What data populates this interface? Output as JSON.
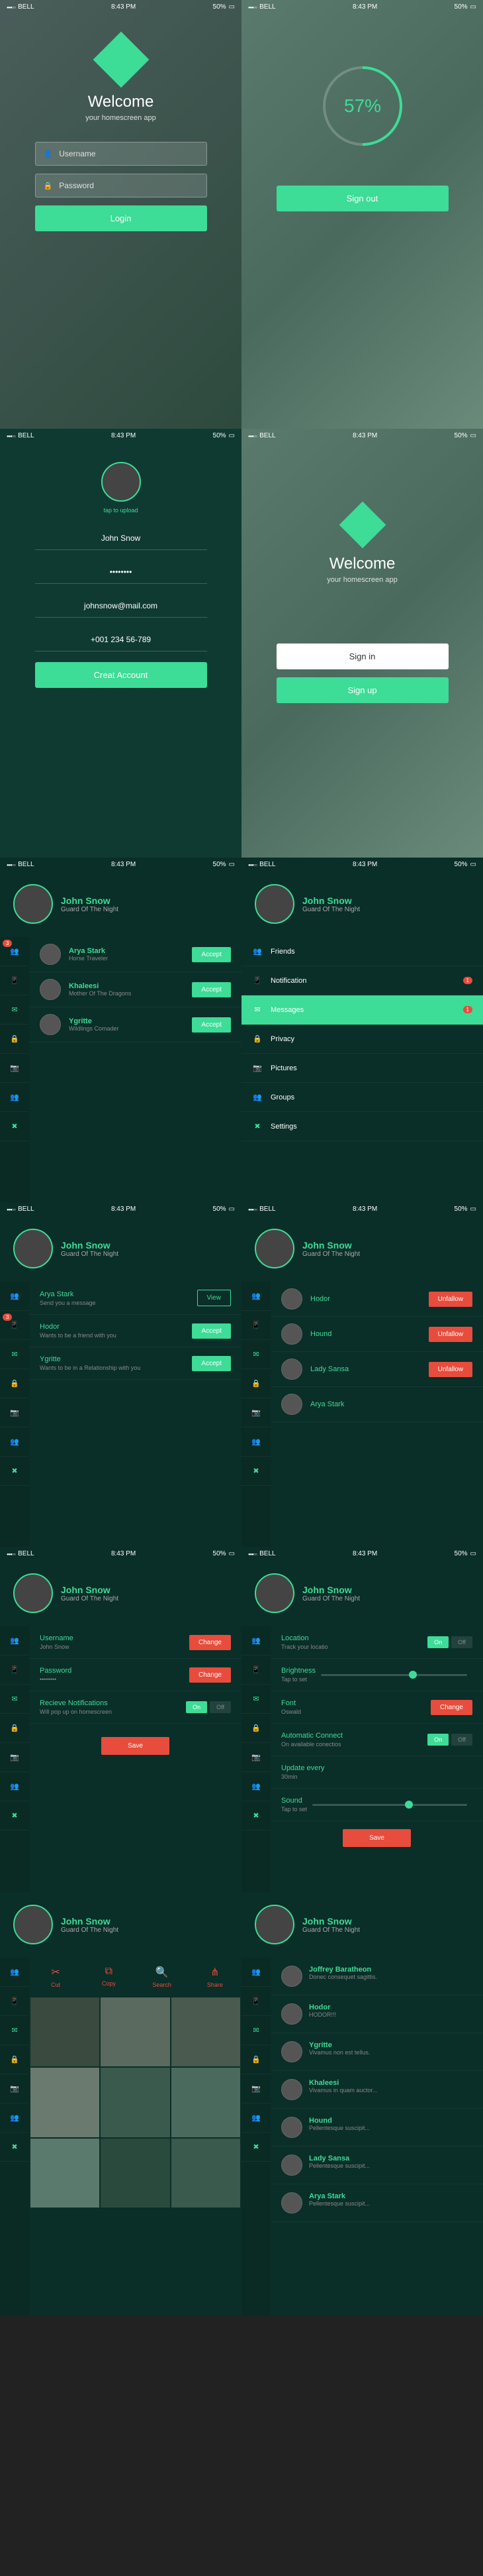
{
  "status": {
    "carrier": "BELL",
    "time": "8:43 PM",
    "battery": "50%"
  },
  "welcome": {
    "title": "Welcome",
    "sub": "your homescreen app",
    "username": "Username",
    "password": "Password",
    "login": "Login"
  },
  "progress": {
    "pct": "57%",
    "signout": "Sign out"
  },
  "register": {
    "upload": "tap to upload",
    "name": "John Snow",
    "pass": "••••••••",
    "email": "johnsnow@mail.com",
    "phone": "+001 234 56-789",
    "create": "Creat Account"
  },
  "auth": {
    "title": "Welcome",
    "sub": "your homescreen app",
    "signin": "Sign in",
    "signup": "Sign up"
  },
  "profile": {
    "name": "John Snow",
    "sub": "Guard Of The Night"
  },
  "requests": [
    {
      "name": "Arya Stark",
      "sub": "Horse Traveler",
      "btn": "Accept"
    },
    {
      "name": "Khaleesi",
      "sub": "Mother Of The Dragons",
      "btn": "Accept"
    },
    {
      "name": "Ygritte",
      "sub": "Wildlings Comader",
      "btn": "Accept"
    }
  ],
  "menu": [
    "Friends",
    "Notification",
    "Messages",
    "Privacy",
    "Pictures",
    "Groups",
    "Settings"
  ],
  "notifs": [
    {
      "name": "Arya Stark",
      "msg": "Send you a message",
      "btn": "View",
      "style": "outline"
    },
    {
      "name": "Hodor",
      "msg": "Wants to be a friend with you",
      "btn": "Accept",
      "style": "accent"
    },
    {
      "name": "Ygritte",
      "msg": "Wants to be in a Relationship with you",
      "btn": "Accept",
      "style": "accent"
    }
  ],
  "friends": [
    {
      "name": "Hodor",
      "btn": "Unfallow"
    },
    {
      "name": "Hound",
      "btn": "Unfallow"
    },
    {
      "name": "Lady Sansa",
      "btn": "Unfallow"
    },
    {
      "name": "Arya Stark",
      "btn": ""
    }
  ],
  "settings1": [
    {
      "lbl": "Username",
      "val": "John Snow",
      "btn": "Change"
    },
    {
      "lbl": "Password",
      "val": "••••••••",
      "btn": "Change"
    },
    {
      "lbl": "Recieve Notifications",
      "val": "Will pop up on homescreen",
      "toggle": true
    }
  ],
  "settings2": [
    {
      "lbl": "Location",
      "val": "Track your locatio",
      "toggle": true
    },
    {
      "lbl": "Brightness",
      "val": "Tap to set",
      "slider": true
    },
    {
      "lbl": "Font",
      "val": "Oswald",
      "btn": "Change"
    },
    {
      "lbl": "Automatic Connect",
      "val": "On available conectios",
      "toggle": true
    },
    {
      "lbl": "Update every",
      "val": "30min"
    },
    {
      "lbl": "Sound",
      "val": "Tap to set",
      "slider": true
    }
  ],
  "save": "Save",
  "on": "On",
  "off": "Off",
  "actions": [
    "Cut",
    "Copy",
    "Search",
    "Share"
  ],
  "chats": [
    {
      "name": "Joffrey Baratheon",
      "msg": "Donec consequet sagittis."
    },
    {
      "name": "Hodor",
      "msg": "HODOR!!!"
    },
    {
      "name": "Ygritte",
      "msg": "Vivamus non est tellus."
    },
    {
      "name": "Khaleesi",
      "msg": "Vivamus in quam auctor..."
    },
    {
      "name": "Hound",
      "msg": "Pellentesque suscipit..."
    },
    {
      "name": "Lady Sansa",
      "msg": "Pellentesque suscipit..."
    },
    {
      "name": "Arya Stark",
      "msg": "Pellentesque suscipit..."
    }
  ]
}
